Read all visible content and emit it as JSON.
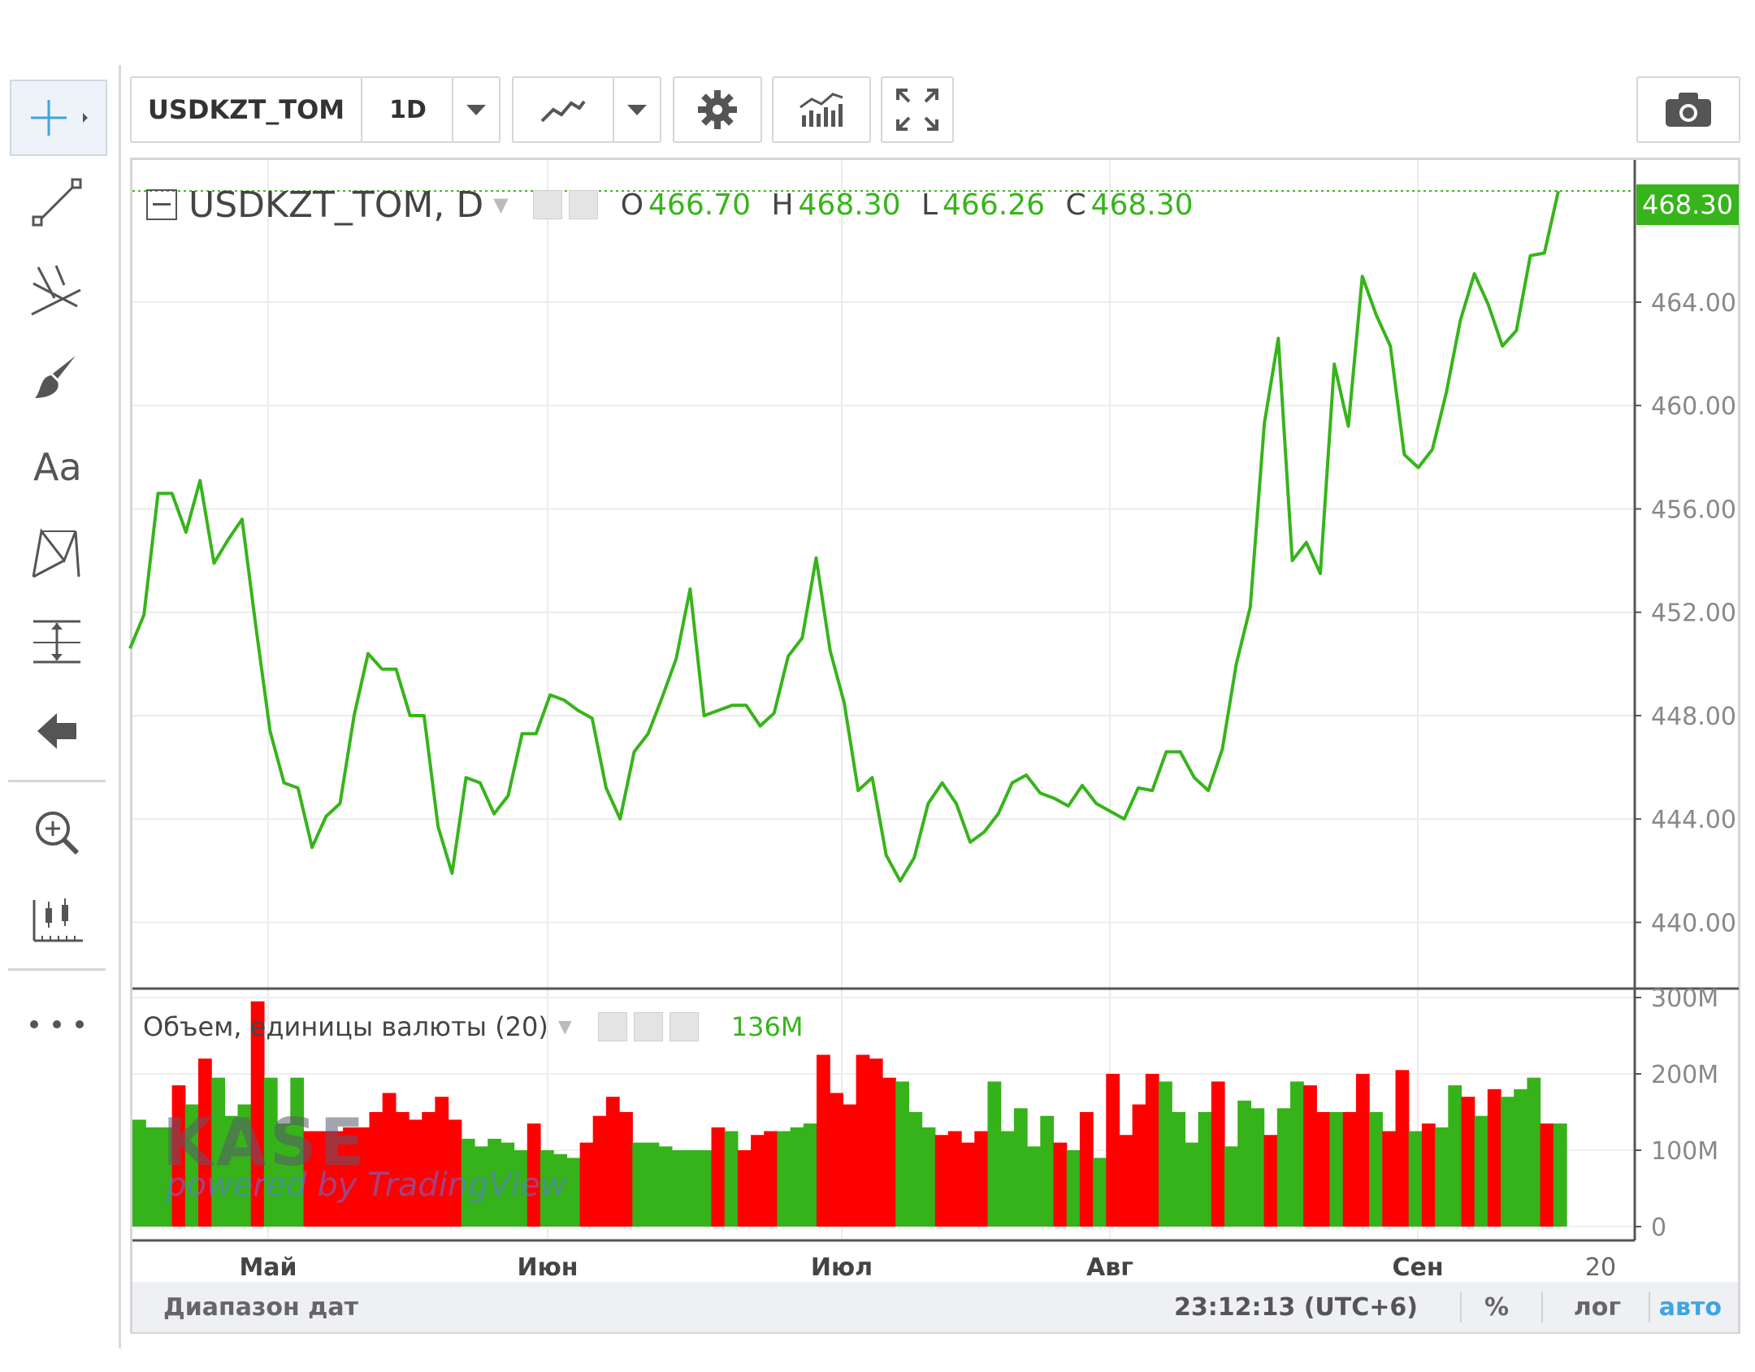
{
  "toolbar": {
    "symbol": "USDKZT_TOM",
    "interval": "1D"
  },
  "legend": {
    "title": "USDKZT_TOM, D",
    "open_key": "O",
    "open": "466.70",
    "high_key": "H",
    "high": "468.30",
    "low_key": "L",
    "low": "466.26",
    "close_key": "C",
    "close": "468.30"
  },
  "price_tag": "468.30",
  "volume_legend": {
    "title": "Объем, единицы валюты (20)",
    "value": "136M"
  },
  "watermark": {
    "brand": "KASE",
    "sub": "powered by TradingView"
  },
  "footer": {
    "range": "Диапазон дат",
    "time": "23:12:13 (UTC+6)",
    "percent": "%",
    "log": "лог",
    "auto": "авто"
  },
  "colors": {
    "line": "#37b41b",
    "up": "#36b21a",
    "down": "#ff0000",
    "accent": "#3da5e0"
  },
  "chart_data": [
    {
      "type": "line",
      "title": "USDKZT_TOM, D",
      "x_tick_labels": [
        "Май",
        "Июн",
        "Июл",
        "Авг",
        "Сен",
        "20"
      ],
      "y_tick_labels": [
        "440.00",
        "444.00",
        "448.00",
        "452.00",
        "456.00",
        "460.00",
        "464.00"
      ],
      "ylim": [
        437.5,
        469.5
      ],
      "grid": true,
      "series": [
        {
          "name": "USDKZT_TOM",
          "values": [
            450.6,
            451.9,
            456.6,
            456.6,
            455.1,
            457.1,
            453.9,
            454.8,
            455.6,
            451.4,
            447.4,
            445.4,
            445.2,
            442.9,
            444.1,
            444.6,
            448.0,
            450.4,
            449.8,
            449.8,
            448.0,
            448.0,
            443.7,
            441.9,
            445.6,
            445.4,
            444.2,
            444.9,
            447.3,
            447.3,
            448.8,
            448.6,
            448.2,
            447.9,
            445.2,
            444.0,
            446.6,
            447.3,
            448.7,
            450.2,
            452.9,
            448.0,
            448.2,
            448.4,
            448.4,
            447.6,
            448.1,
            450.3,
            451.0,
            454.1,
            450.5,
            448.5,
            445.1,
            445.6,
            442.6,
            441.6,
            442.5,
            444.6,
            445.4,
            444.6,
            443.1,
            443.5,
            444.2,
            445.4,
            445.7,
            445.0,
            444.8,
            444.5,
            445.3,
            444.6,
            444.3,
            444.0,
            445.2,
            445.1,
            446.6,
            446.6,
            445.6,
            445.1,
            446.7,
            450.0,
            452.2,
            459.3,
            462.6,
            454.0,
            454.7,
            453.5,
            461.6,
            459.2,
            465.0,
            463.5,
            462.3,
            458.1,
            457.6,
            458.3,
            460.5,
            463.3,
            465.1,
            463.9,
            462.3,
            462.9,
            465.8,
            465.9,
            468.3
          ]
        }
      ]
    },
    {
      "type": "bar",
      "title": "Объем, единицы валюты (20)",
      "y_tick_labels": [
        "0",
        "100M",
        "200M",
        "300M"
      ],
      "ylim": [
        0,
        300
      ],
      "series": [
        {
          "name": "Объем",
          "values": [
            140,
            130,
            130,
            185,
            160,
            220,
            195,
            145,
            160,
            295,
            195,
            135,
            195,
            125,
            125,
            125,
            130,
            130,
            150,
            175,
            150,
            140,
            150,
            170,
            140,
            115,
            105,
            115,
            110,
            100,
            135,
            100,
            95,
            90,
            110,
            145,
            170,
            150,
            110,
            110,
            105,
            100,
            100,
            100,
            130,
            125,
            100,
            120,
            125,
            125,
            130,
            135,
            225,
            175,
            160,
            225,
            220,
            195,
            190,
            150,
            130,
            120,
            125,
            110,
            125,
            190,
            125,
            155,
            105,
            145,
            110,
            100,
            150,
            90,
            200,
            120,
            160,
            200,
            190,
            150,
            110,
            150,
            190,
            105,
            165,
            155,
            120,
            155,
            190,
            185,
            150,
            150,
            150,
            200,
            150,
            125,
            205,
            125,
            135,
            130,
            185,
            170,
            145,
            180,
            170,
            180,
            195,
            135,
            135
          ],
          "up": [
            1,
            1,
            1,
            0,
            1,
            0,
            1,
            1,
            1,
            0,
            1,
            1,
            1,
            0,
            0,
            0,
            0,
            0,
            0,
            0,
            0,
            0,
            0,
            0,
            0,
            1,
            1,
            1,
            1,
            1,
            0,
            1,
            1,
            1,
            0,
            0,
            0,
            0,
            1,
            1,
            1,
            1,
            1,
            1,
            0,
            1,
            0,
            0,
            0,
            1,
            1,
            1,
            0,
            0,
            0,
            0,
            0,
            0,
            1,
            1,
            1,
            0,
            0,
            0,
            0,
            1,
            1,
            1,
            1,
            1,
            0,
            1,
            0,
            1,
            0,
            0,
            0,
            0,
            1,
            1,
            1,
            1,
            0,
            1,
            1,
            1,
            0,
            1,
            1,
            0,
            0,
            1,
            0,
            0,
            1,
            0,
            0,
            1,
            0,
            1,
            1,
            0,
            1,
            0,
            1,
            1,
            1,
            0,
            1
          ]
        }
      ]
    }
  ]
}
